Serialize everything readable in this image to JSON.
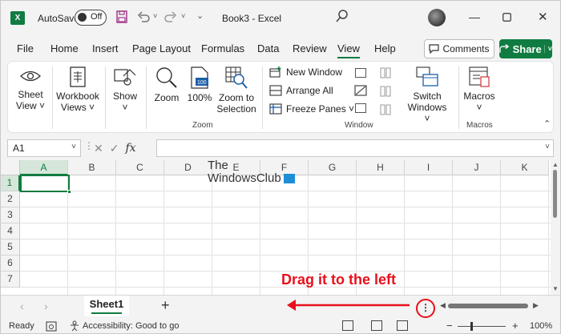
{
  "titlebar": {
    "app_badge": "X",
    "autosave_label": "AutoSave",
    "autosave_state": "Off",
    "title": "Book3 - Excel"
  },
  "menu": {
    "tabs": [
      "File",
      "Home",
      "Insert",
      "Page Layout",
      "Formulas",
      "Data",
      "Review",
      "View",
      "Help"
    ],
    "active_tab": "View",
    "comments_label": "Comments",
    "share_label": "Share"
  },
  "ribbon": {
    "sheet_view": [
      "Sheet",
      "View ˅"
    ],
    "workbook_views": [
      "Workbook",
      "Views ˅"
    ],
    "show": [
      "Show",
      "˅"
    ],
    "zoom": "Zoom",
    "zoom_100": "100%",
    "zoom_to_selection": [
      "Zoom to",
      "Selection"
    ],
    "zoom_group": "Zoom",
    "new_window": "New Window",
    "arrange_all": "Arrange All",
    "freeze_panes": "Freeze Panes ˅",
    "switch_windows": [
      "Switch",
      "Windows ˅"
    ],
    "window_group": "Window",
    "macros": [
      "Macros",
      "˅"
    ],
    "macros_group": "Macros"
  },
  "formula_bar": {
    "name_box": "A1",
    "fx": "fx",
    "formula": ""
  },
  "grid": {
    "columns": [
      "A",
      "B",
      "C",
      "D",
      "E",
      "F",
      "G",
      "H",
      "I",
      "J",
      "K"
    ],
    "rows": [
      "1",
      "2",
      "3",
      "4",
      "5",
      "6",
      "7"
    ],
    "selected_column": "A",
    "selected_row": "1",
    "watermark_line1": "The",
    "watermark_line2": "WindowsClub"
  },
  "sheet_tabs": {
    "sheets": [
      "Sheet1"
    ],
    "active_sheet": "Sheet1",
    "add_symbol": "+",
    "annotation": "Drag it to the left",
    "split_handle_symbol": "⋮"
  },
  "status_bar": {
    "ready": "Ready",
    "accessibility": "Accessibility: Good to go",
    "zoom_minus": "−",
    "zoom_plus": "+",
    "zoom_level": "100%",
    "zoom_value_pct": 100
  },
  "colors": {
    "accent": "#107c41",
    "annotation": "#e8101a"
  }
}
